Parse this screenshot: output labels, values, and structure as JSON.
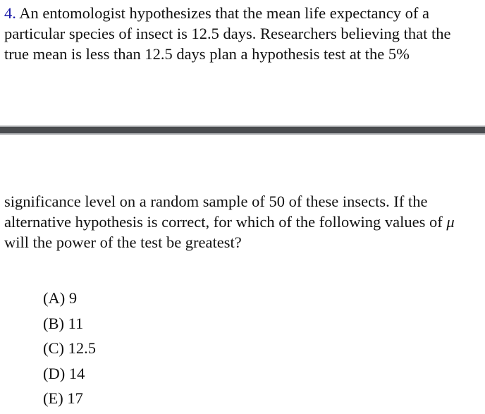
{
  "question": {
    "number": "4.",
    "part1_lines": [
      " An entomologist hypothesizes that the mean life expectancy of a",
      "particular species of insect is 12.5 days. Researchers believing that the",
      "true mean is less than 12.5 days plan a hypothesis test at the 5%"
    ],
    "part2_lines": [
      "significance level on a random sample of 50 of these insects. If the",
      "alternative hypothesis is correct, for which of the following values of ",
      "will the power of the test be greatest?"
    ],
    "symbol": "μ"
  },
  "choices": [
    "(A) 9",
    "(B) 11",
    "(C) 12.5",
    "(D) 14",
    "(E) 17"
  ],
  "colors": {
    "question_number": "#1a1aa8",
    "divider": "#4a4c4f"
  }
}
